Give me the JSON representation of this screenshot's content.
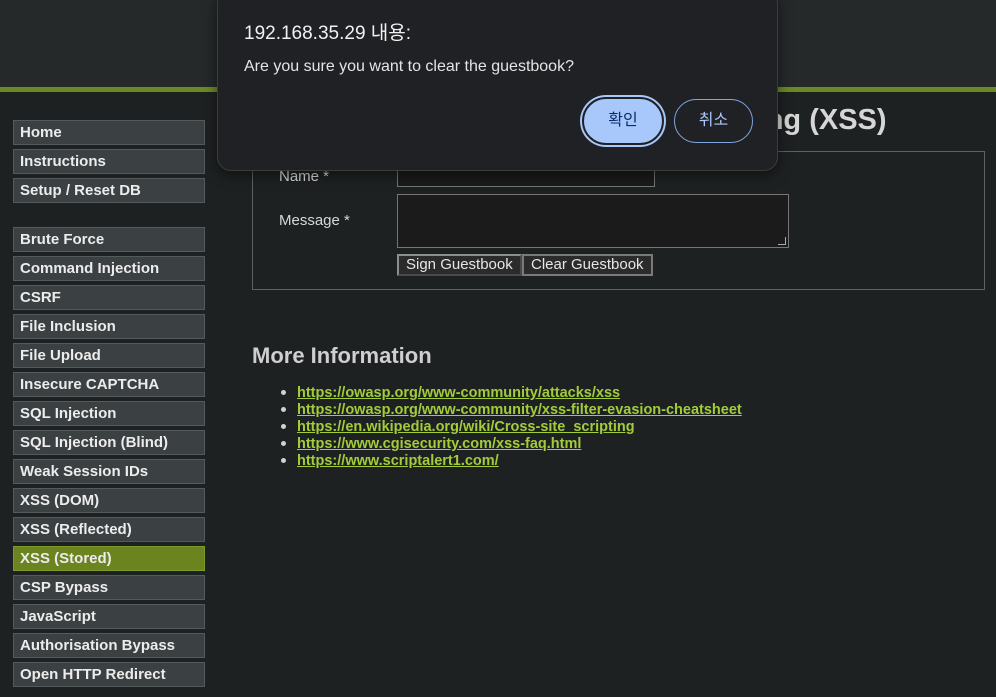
{
  "page": {
    "title_partial": "ting (XSS)"
  },
  "sidebar": {
    "group1": [
      "Home",
      "Instructions",
      "Setup / Reset DB"
    ],
    "group2": [
      "Brute Force",
      "Command Injection",
      "CSRF",
      "File Inclusion",
      "File Upload",
      "Insecure CAPTCHA",
      "SQL Injection",
      "SQL Injection (Blind)",
      "Weak Session IDs",
      "XSS (DOM)",
      "XSS (Reflected)",
      "XSS (Stored)",
      "CSP Bypass",
      "JavaScript",
      "Authorisation Bypass",
      "Open HTTP Redirect"
    ],
    "active": "XSS (Stored)"
  },
  "form": {
    "name_label": "Name *",
    "message_label": "Message *",
    "name_value": "",
    "message_value": "",
    "sign_button": "Sign Guestbook",
    "clear_button": "Clear Guestbook"
  },
  "more_info": {
    "heading": "More Information",
    "links": [
      "https://owasp.org/www-community/attacks/xss",
      "https://owasp.org/www-community/xss-filter-evasion-cheatsheet",
      "https://en.wikipedia.org/wiki/Cross-site_scripting",
      "https://www.cgisecurity.com/xss-faq.html",
      "https://www.scriptalert1.com/"
    ]
  },
  "dialog": {
    "title": "192.168.35.29 내용:",
    "message": "Are you sure you want to clear the guestbook?",
    "ok_label": "확인",
    "cancel_label": "취소"
  },
  "colors": {
    "accent": "#6b8a23",
    "link": "#a3cc3a",
    "dialog_primary": "#a8c7fa"
  }
}
